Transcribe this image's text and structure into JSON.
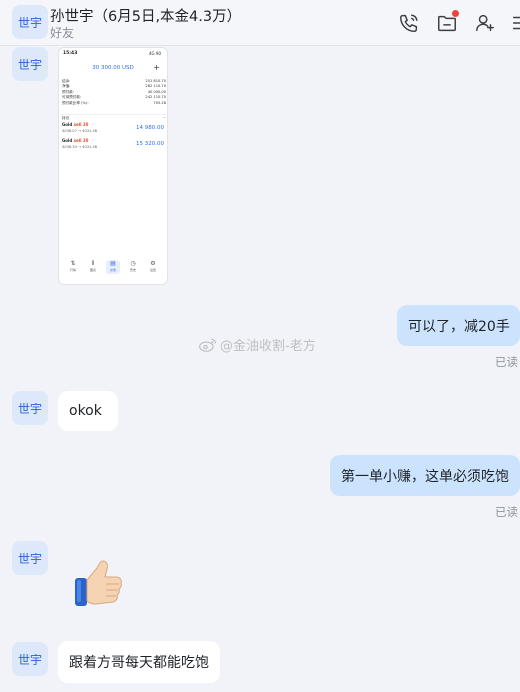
{
  "header": {
    "avatar_text": "世宇",
    "title": "孙世宇（6月5日,本金4.3万）",
    "subtitle": "好友"
  },
  "contact": {
    "avatar_text": "世宇"
  },
  "screenshot": {
    "time": "15:43",
    "status_right": "4G 90",
    "balance": "30 300.00 USD",
    "plus": "+",
    "rows": [
      {
        "label": "结余:",
        "value": "251 810.70"
      },
      {
        "label": "净值:",
        "value": "282 110.70"
      },
      {
        "label": "预付款:",
        "value": "40 000.00"
      },
      {
        "label": "可用预付款:",
        "value": "242 110.70"
      },
      {
        "label": "预付款比率 (%):",
        "value": "705.28"
      }
    ],
    "positions_label": "持仓",
    "positions_more": "···",
    "trades": [
      {
        "symbol": "Gold",
        "side": "sell 20",
        "prices": "4038.07 → 4031.58",
        "profit": "14 980.00"
      },
      {
        "symbol": "Gold",
        "side": "sell 20",
        "prices": "4038.34 → 4031.58",
        "profit": "15 320.00"
      }
    ],
    "tabs": [
      {
        "glyph": "⇅",
        "label": "行情"
      },
      {
        "glyph": "⫴",
        "label": "图表"
      },
      {
        "glyph": "▤",
        "label": "交易"
      },
      {
        "glyph": "◷",
        "label": "历史"
      },
      {
        "glyph": "⚙",
        "label": "设置"
      }
    ]
  },
  "messages": [
    {
      "direction": "outgoing",
      "text": "可以了，减20手",
      "status": "已读"
    },
    {
      "direction": "incoming",
      "text": "okok"
    },
    {
      "direction": "outgoing",
      "text": "第一单小赚，这单必须吃饱",
      "status": "已读"
    },
    {
      "direction": "incoming",
      "type": "emoji",
      "emoji": "thumbs-up"
    },
    {
      "direction": "incoming",
      "text": "跟着方哥每天都能吃饱"
    }
  ],
  "watermark": "@金油收割-老方",
  "colors": {
    "accent": "#2a63d6",
    "outgoing_bubble": "#cce3fd",
    "incoming_bubble": "#ffffff",
    "background": "#f1f3f9",
    "unread_dot": "#f04142"
  }
}
